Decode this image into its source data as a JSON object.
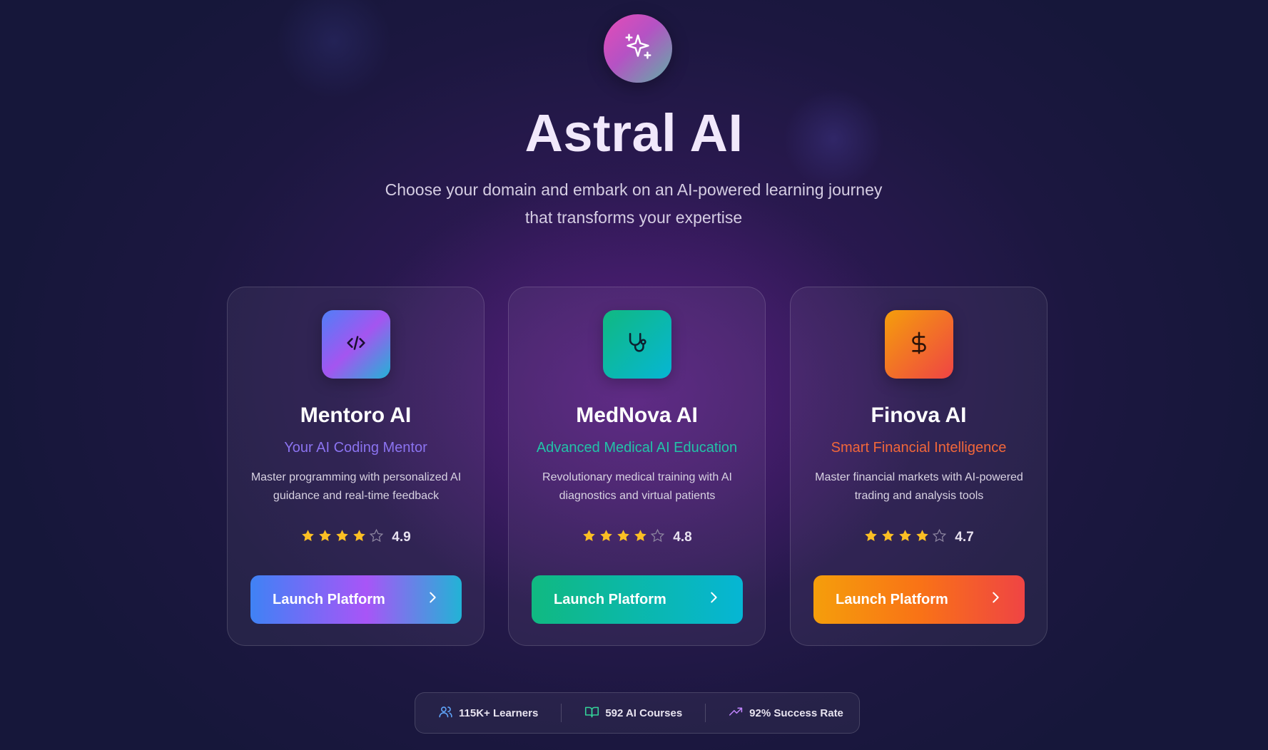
{
  "header": {
    "logo_icon": "sparkles-icon",
    "title": "Astral AI",
    "subtitle_line1": "Choose your domain and embark on an AI-powered learning journey",
    "subtitle_line2": "that transforms your expertise"
  },
  "cards": [
    {
      "name": "Mentoro AI",
      "tagline": "Your AI Coding Mentor",
      "description": "Master programming with personalized AI guidance and real-time feedback",
      "rating": "4.9",
      "stars_filled": 4,
      "button_label": "Launch Platform",
      "icon": "code-icon",
      "colors": {
        "from": "#4f7ff7",
        "mid": "#a455f0",
        "to": "#22b3d6",
        "tagline": "#8b73f0"
      }
    },
    {
      "name": "MedNova AI",
      "tagline": "Advanced Medical AI Education",
      "description": "Revolutionary medical training with AI diagnostics and virtual patients",
      "rating": "4.8",
      "stars_filled": 4,
      "button_label": "Launch Platform",
      "icon": "stethoscope-icon",
      "colors": {
        "from": "#10b981",
        "to": "#06b6d4",
        "tagline": "#22c3a8"
      }
    },
    {
      "name": "Finova AI",
      "tagline": "Smart Financial Intelligence",
      "description": "Master financial markets with AI-powered trading and analysis tools",
      "rating": "4.7",
      "stars_filled": 4,
      "button_label": "Launch Platform",
      "icon": "dollar-icon",
      "colors": {
        "from": "#f59e0b",
        "to": "#ef4444",
        "tagline": "#f2673a"
      }
    }
  ],
  "stats": [
    {
      "icon": "users-icon",
      "label": "115K+ Learners",
      "color": "#60a5fa"
    },
    {
      "icon": "book-icon",
      "label": "592 AI Courses",
      "color": "#34d399"
    },
    {
      "icon": "trending-up-icon",
      "label": "92% Success Rate",
      "color": "#c084fc"
    }
  ],
  "star_color": "#fbbf24"
}
